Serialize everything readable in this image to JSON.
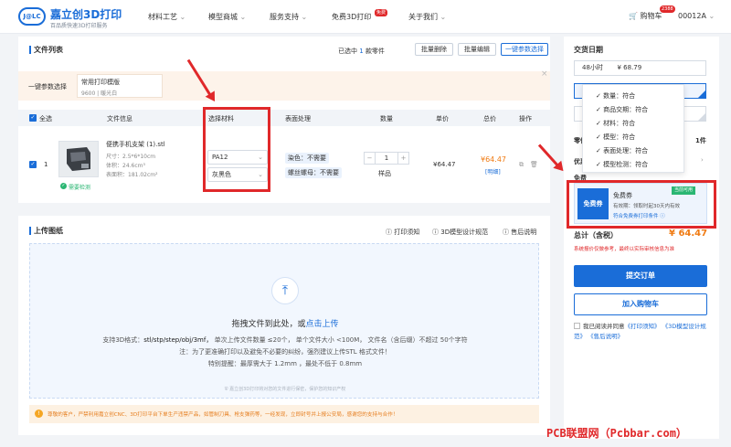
{
  "header": {
    "logo_mark": "J@LC",
    "brand": "嘉立创3D打印",
    "slogan": "百品质快速3D打印服务",
    "nav": [
      "材料工艺",
      "模型商城",
      "服务支持",
      "免费3D打印",
      "关于我们"
    ],
    "free_badge": "免费",
    "cart_label": "购物车",
    "cart_count": "2388",
    "user": "00012A"
  },
  "files": {
    "title": "文件列表",
    "selected_prefix": "已选中",
    "selected_count": "1",
    "selected_suffix": "款零件",
    "batch_delete": "批量删除",
    "batch_edit": "批量编辑",
    "one_click": "一键参数选择",
    "preset_label": "一键参数选择",
    "preset_name": "常用打印模版",
    "preset_desc": "9600 | 暖光白",
    "columns": [
      "全选",
      "文件信息",
      "选择材料",
      "表面处理",
      "数量",
      "单价",
      "总价",
      "操作"
    ],
    "row": {
      "index": "1",
      "name": "便携手机支架 (1).stl",
      "size": "尺寸：2.5*6*10cm",
      "volume": "体积：24.6cm³",
      "surface": "表面积：181.02cm²",
      "detect": "需要检测",
      "material": "PA12",
      "color": "灰黑色",
      "dye": "染色：不需要",
      "thread": "螺丝螺母：不需要",
      "qty": "1",
      "qty_unit": "样品",
      "unit_price": "¥64.47",
      "total": "¥64.47",
      "detail": "[明细]"
    }
  },
  "upload": {
    "title": "上传图纸",
    "links": [
      "打印须知",
      "3D模型设计规范",
      "售后说明"
    ],
    "drop_text": "拖拽文件到此处，或",
    "drop_link": "点击上传",
    "formats_prefix": "支持3D格式：",
    "formats": "stl/stp/step/obj/3mf，",
    "rule": "单次上传文件数量 ≤20个，  单个文件大小 <100M，  文件名（含后缀）不超过 50个字符",
    "note": "注：为了更准确打印以及避免不必要的纠纷，强烈建议上传STL 格式文件！",
    "wall": "特别提醒：最厚需大于 1.2mm ，最处不低于 0.8mm",
    "security": "嘉立创3D打印将对您的文件进行保密，保护您的知识产权",
    "warning": "尊敬的客户，严禁利用嘉立创CNC、3D打印平台下单生产违禁产品，如管制刀具、枪支弹药等，一经发现，立即封号并上报公安局，感谢您的支持与合作！"
  },
  "side": {
    "delivery_title": "交货日期",
    "delivery_value": "48小时       ¥ 68.79",
    "dropdown_items": [
      "数量：符合",
      "商品交期：符合",
      "材料：符合",
      "模型：符合",
      "表面处理：符合",
      "模型检测：符合"
    ],
    "row_label_1": "零件",
    "row_value_1": "1件",
    "row_label_2": "优惠",
    "row_label_3": "免费",
    "coupon_icon": "免费券",
    "coupon_name": "免费券",
    "coupon_status": "当前可用",
    "coupon_expire": "有效期：领取时起30天内有效",
    "coupon_rule": "符合免费券打印条件",
    "total_label": "总计（含税）",
    "total_value": "¥ 64.47",
    "notice": "系统报价仅做参考，最终以实际审核信息为准",
    "submit": "提交订单",
    "add_cart": "加入购物车",
    "agree_prefix": "我已阅读并同意",
    "agree_links": "《打印须知》 《3D模型设计规范》 《售后说明》"
  },
  "watermark": "PCB联盟网（Pcbbar.com）",
  "colors": {
    "accent": "#1a6dd8",
    "price": "#f07b13",
    "alert": "#e0282a"
  }
}
